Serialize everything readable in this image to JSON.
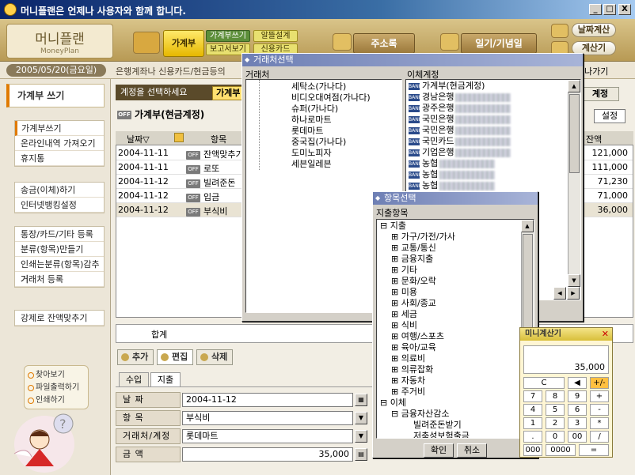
{
  "window": {
    "title": "머니플랜은 언제나 사용자와 함께 합니다.",
    "min": "_",
    "max": "□",
    "close": "X"
  },
  "header": {
    "logo": "머니플랜",
    "logo_sub": "MoneyPlan",
    "main_btn": "가계부",
    "sub_buttons": [
      "가계부쓰기",
      "알뜰설계",
      "보고서보기",
      "신용카드"
    ],
    "address_btn": "주소록",
    "diary_btn": "일기/기념일",
    "date_calc": "날짜계산",
    "calculator": "계산기"
  },
  "datebar": {
    "date": "2005/05/20(금요일)",
    "notice": "은행계좌나 신용카드/현금등의",
    "exit": "나가기"
  },
  "sidebar": {
    "title": "가계부 쓰기",
    "group1": [
      "가계부쓰기",
      "온라인내역 가져오기",
      "휴지통"
    ],
    "group2": [
      "송금(이체)하기",
      "인터넷뱅킹설정"
    ],
    "group3": [
      "통장/카드/기타 등록",
      "분류(항목)만들기",
      "인쇄는분류(항목)감추기",
      "거래처 등록"
    ],
    "group4": [
      "강제로 잔액맞추기"
    ],
    "utils": [
      "찾아보기",
      "파일출력하기",
      "인쇄하기"
    ]
  },
  "main": {
    "select_prompt": "계정을 선택하세요",
    "select_tab": "가계부",
    "account_name": "가계부(현금계정)",
    "account_btn": "계정",
    "settings_btn": "설정",
    "columns": {
      "date": "날짜▽",
      "item": "항목",
      "balance": "잔액"
    },
    "rows": [
      {
        "date": "2004-11-11",
        "item": "잔액맞추기",
        "balance": "121,000"
      },
      {
        "date": "2004-11-11",
        "item": "로또",
        "balance": "111,000"
      },
      {
        "date": "2004-11-12",
        "item": "빌려준돈",
        "balance": "71,230"
      },
      {
        "date": "2004-11-12",
        "item": "입금",
        "balance": "71,000"
      },
      {
        "date": "2004-11-12",
        "item": "부식비",
        "balance": "36,000"
      }
    ],
    "sum_label": "합계",
    "tools": [
      "추가",
      "편집",
      "삭제"
    ],
    "tabs": [
      "수입",
      "지출"
    ],
    "form": {
      "date_label": "날      짜",
      "date_value": "2004-11-12",
      "item_label": "항      목",
      "item_value": "부식비",
      "vendor_label": "거래처/계정",
      "vendor_value": "롯데마트",
      "amount_label": "금      액",
      "amount_value": "35,000"
    }
  },
  "vendor_dialog": {
    "title": "거래처선택",
    "left_header": "거래처",
    "vendors": [
      "세탁소(가나다)",
      "비디오대여점(가나다)",
      "슈퍼(가나다)",
      "하나로마트",
      "롯데마트",
      "중국집(가나다)",
      "도미노피자",
      "세븐일레븐"
    ],
    "right_header": "이체계정",
    "accounts": [
      "가계부(현금계정)",
      "경남은행",
      "광주은행",
      "국민은행",
      "국민은행",
      "국민카드",
      "기업은행",
      "농협",
      "농협",
      "농협"
    ],
    "bank_icon": "BANK"
  },
  "category_dialog": {
    "title": "항목선택",
    "header": "지출항목",
    "root": "지출",
    "items": [
      "가구/가전/가사",
      "교통/통신",
      "금융지출",
      "기타",
      "문화/오락",
      "미용",
      "사회/종교",
      "세금",
      "식비",
      "여행/스포츠",
      "육아/교육",
      "의료비",
      "의류잡화",
      "자동차",
      "주거비"
    ],
    "root2": "이체",
    "sub": "금융자산감소",
    "leaves": [
      "빌려준돈받기",
      "저축성보험출금"
    ],
    "ok": "확인",
    "cancel": "취소"
  },
  "calculator": {
    "title": "미니계산기",
    "display": "35,000",
    "keys": [
      "C",
      "◀",
      "+/-",
      "7",
      "8",
      "9",
      "+",
      "4",
      "5",
      "6",
      "-",
      "1",
      "2",
      "3",
      "*",
      ".",
      "0",
      "00",
      "/",
      "000",
      "0000",
      "="
    ]
  },
  "colors": {
    "accent": "#e07a00",
    "title_bar": "#0a246a",
    "dialog_title": "#6e7fb4",
    "calc_title": "#d8bf3a"
  }
}
